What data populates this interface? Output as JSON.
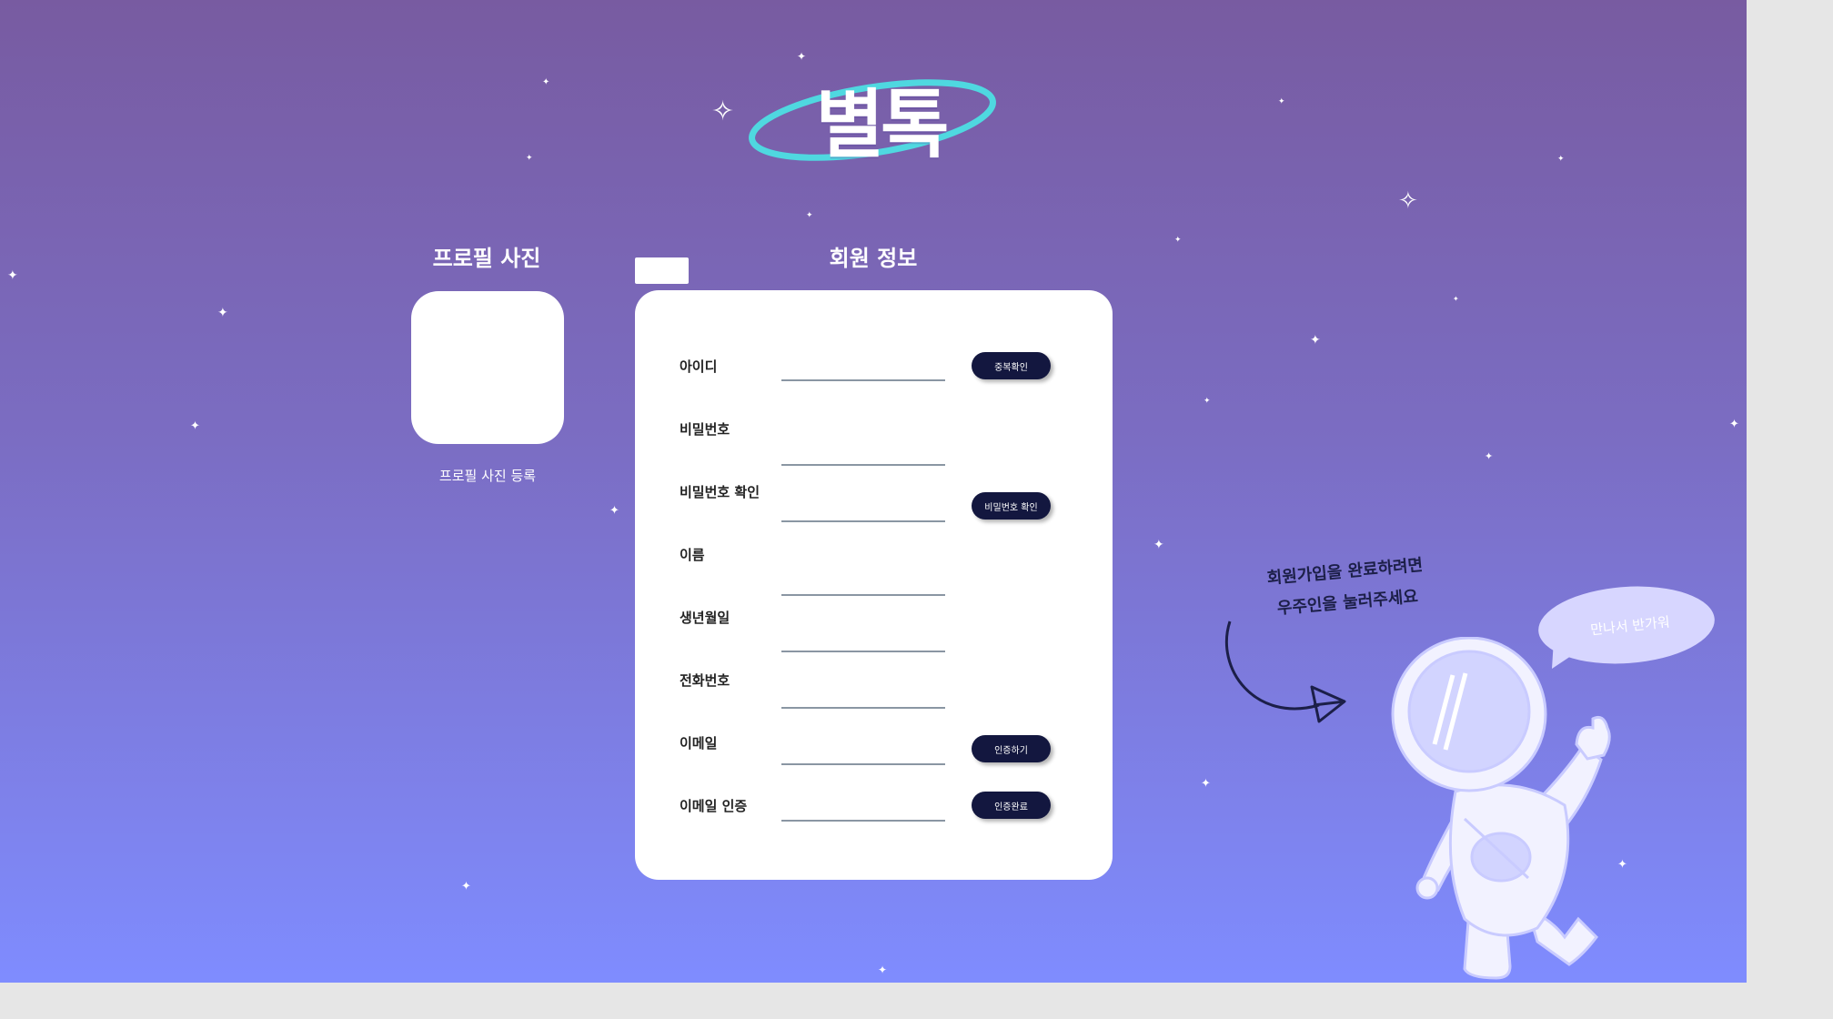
{
  "logo": {
    "text": "별톡"
  },
  "profile": {
    "title": "프로필 사진",
    "register_label": "프로필 사진 등록"
  },
  "member": {
    "title": "회원 정보",
    "fields": [
      {
        "label": "아이디",
        "value": "",
        "button": "중복확인"
      },
      {
        "label": "비밀번호",
        "value": ""
      },
      {
        "label": "비밀번호 확인",
        "value": "",
        "button": "비밀번호 확인"
      },
      {
        "label": "이름",
        "value": ""
      },
      {
        "label": "생년월일",
        "value": ""
      },
      {
        "label": "전화번호",
        "value": ""
      },
      {
        "label": "이메일",
        "value": "",
        "button": "인증하기"
      },
      {
        "label": "이메일 인증",
        "value": "",
        "button": "인증완료"
      }
    ]
  },
  "hint": {
    "line1": "회원가입을 완료하려면",
    "line2": "우주인을 눌러주세요"
  },
  "bubble": {
    "text": "만나서 반가워"
  },
  "icons": {
    "logo_ring": "orbit-ring-icon",
    "astronaut": "astronaut-illustration",
    "arrow": "curved-arrow-icon",
    "stars": "sparkle-star-icon"
  },
  "colors": {
    "bg_top": "#785ba1",
    "bg_bottom": "#7f8cff",
    "logo_ring": "#4fd8e0",
    "button": "#13173f",
    "card": "#ffffff",
    "astronaut_fill": "#f2f2ff",
    "astronaut_visor": "#d2d4ff",
    "bubble": "#d7d6ff"
  }
}
